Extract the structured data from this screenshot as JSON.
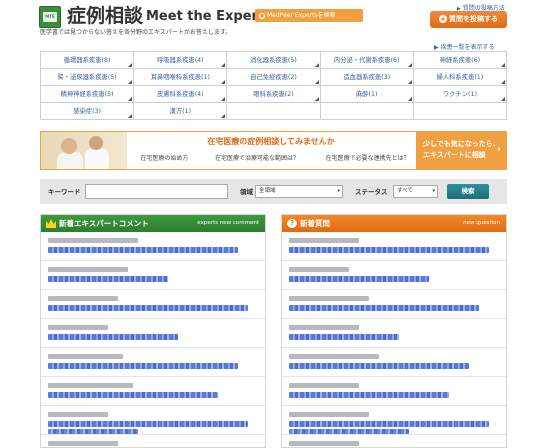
{
  "header": {
    "logo_text": "MTE",
    "title": "症例相談",
    "title_en": "Meet the Experts",
    "search_pill": "MedPeer Expertsを検索",
    "howto_link": "質問の投稿方法",
    "post_button": "質問を投稿する",
    "tagline": "医学書では見つからない答えを各分野のエキスパートがお答えします。",
    "all_diseases_link": "疾患一覧を表示する"
  },
  "categories": [
    "循環器系疾患(8)",
    "呼吸器系疾患(4)",
    "消化器系疾患(5)",
    "内分泌・代謝系疾患(6)",
    "神経系疾患(6)",
    "腎・泌尿器系疾患(5)",
    "耳鼻咽喉科系疾患(1)",
    "自己免疫疾患(2)",
    "造血器系疾患(3)",
    "婦人科系疾患(1)",
    "精神神経系疾患(5)",
    "皮膚科系疾患(4)",
    "眼科系疾患(2)",
    "麻酔(1)",
    "ワクチン(1)",
    "感染症(3)",
    "漢方(1)",
    "",
    "",
    ""
  ],
  "banner": {
    "title": "在宅医療の症例相談してみませんか",
    "links": [
      "在宅医療の始め方",
      "在宅医療で治療可能な範囲は？",
      "在宅医療で必要な連携先とは？"
    ],
    "cta_line1": "少しでも気になったら、",
    "cta_line2": "エキスパートに相談",
    "cta_arrow": "›"
  },
  "search": {
    "keyword_label": "キーワード",
    "keyword_value": "",
    "field_label": "領域",
    "field_value": "全領域",
    "status_label": "ステータス",
    "status_value": "すべて",
    "button": "検索"
  },
  "panels": {
    "left": {
      "title": "新着エキスパートコメント",
      "subtitle": "experts new comment"
    },
    "right": {
      "title": "新着質問",
      "subtitle": "new question",
      "icon": "?"
    }
  },
  "colors": {
    "brand_green": "#3d8b3d",
    "accent_orange": "#f0a040",
    "link_blue": "#3366aa",
    "search_teal": "#1f6f7a"
  }
}
